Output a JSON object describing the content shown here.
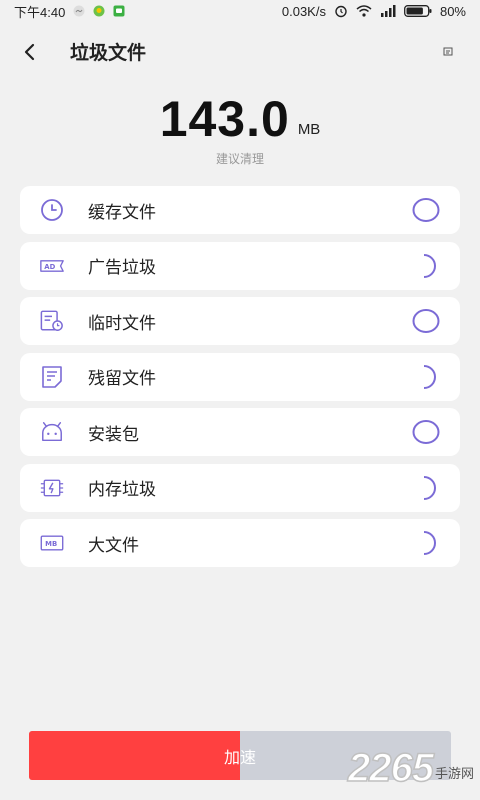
{
  "status_bar": {
    "time": "下午4:40",
    "network_speed": "0.03K/s",
    "battery": "80%",
    "battery_level": 0.8
  },
  "header": {
    "title": "垃圾文件",
    "back_icon": "chevron-left-icon",
    "action_icon": "small-document-icon"
  },
  "summary": {
    "size_value": "143.0",
    "size_unit": "MB",
    "hint": "建议清理"
  },
  "categories": [
    {
      "label": "缓存文件",
      "icon": "clock-icon",
      "status": "done"
    },
    {
      "label": "广告垃圾",
      "icon": "ad-icon",
      "status": "scanning"
    },
    {
      "label": "临时文件",
      "icon": "temp-file-icon",
      "status": "done"
    },
    {
      "label": "残留文件",
      "icon": "residual-file-icon",
      "status": "scanning"
    },
    {
      "label": "安装包",
      "icon": "android-icon",
      "status": "done"
    },
    {
      "label": "内存垃圾",
      "icon": "memory-icon",
      "status": "scanning"
    },
    {
      "label": "大文件",
      "icon": "mb-icon",
      "status": "scanning"
    }
  ],
  "action_button": {
    "label": "加速",
    "progress": 0.5
  },
  "watermark": {
    "number": "2265",
    "text": "手游网"
  },
  "colors": {
    "accent": "#7b6bd6",
    "button_fill": "#ff4040",
    "button_track": "#cdd0d8"
  }
}
